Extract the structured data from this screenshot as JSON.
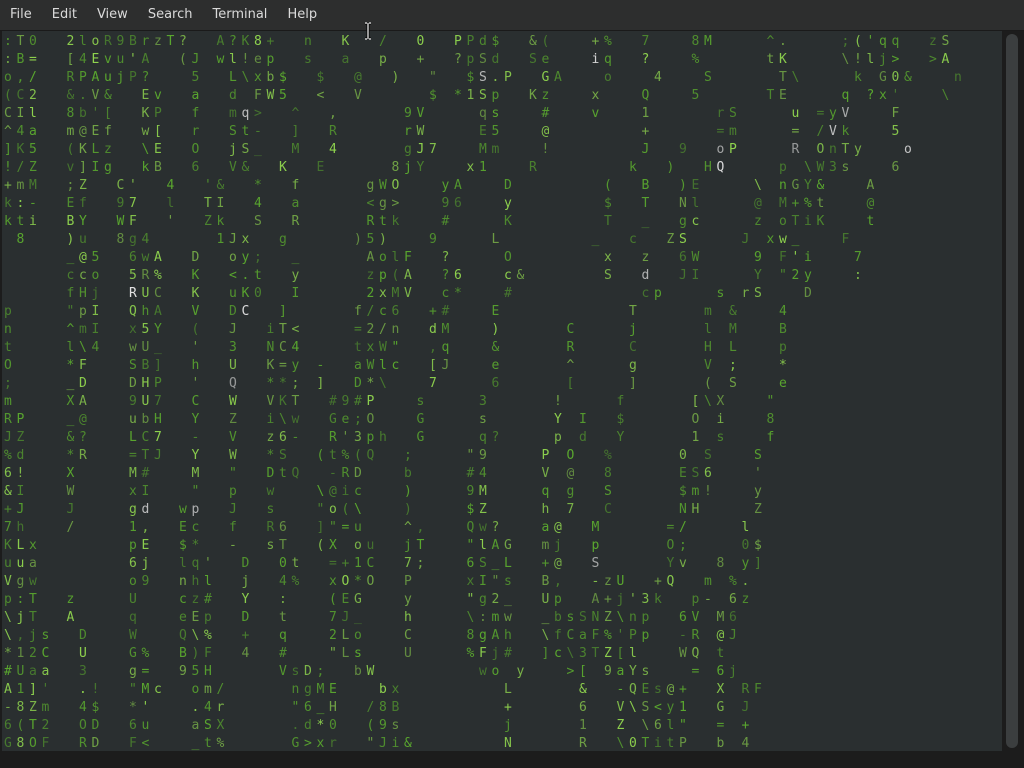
{
  "menubar": {
    "items": [
      {
        "label": "File"
      },
      {
        "label": "Edit"
      },
      {
        "label": "View"
      },
      {
        "label": "Search"
      },
      {
        "label": "Terminal"
      },
      {
        "label": "Help"
      }
    ]
  },
  "colors": {
    "terminal_background": "#2a2f30",
    "rain_green": "#5aa82e",
    "rain_green_bright": "#8fd44e",
    "highlight_white": "#e8e8e8",
    "menubar_background": "#2d2e2e",
    "menubar_text": "#dadada"
  },
  "icons": {
    "cursor": "ibeam-cursor-icon",
    "scrollbar": "scrollbar-thumb"
  },
  "terminal": {
    "rows": [
      ":T0  2loR9BrzT?  A?K8+  n  K  /  0  PPd$  &(   +%  7   8M    ^.    ;('qq  zS",
      ":B=  [4Evu'A  (J wl!ep  s  a  p  +  ?pSd  Se   iq  ?   %     tK    \\!lj>  >A",
      "o,/  RPAujP?   5  L\\xb$  $  @  )  \"  $S.P  GA   o   4   S     T\\    k G0&   n",
      "(C2  &.V&  Ev  a  d FW5  <  V     $ *1Sp  Kz   x   Q   5     TE    q ?x'   \\",
      "CIl  8b'[  KP  f  mq>  ^  ,     9V    qs   #   v   1     rS    u =yV   F",
      "^4a  m@Ef  w[  r  St-  ]  R     rW    E5   @       +     =m    = /Vk   5",
      "]K5  (KLz  \\E  O  jS_  M  4     gJ7   Mm   !       J  9  oP    R OnTy   o",
      "!/Z  v]Ig  kB  6  V&  K  E     8jY   x1   R       k  )  HQ    p \\W3s   6",
      "+mM  ;Z  C'  4  '&  *  f     gWO   yA   D       (  B  )E    \\ nGY&   A",
      "k:-  Ef  97  l  TI  4  a     <g>   96   y       $  T  Nl    @ M+%t   @",
      "kti  BY  WF  '  Zk  S  R     Rtk   #    K       T  _  gc    z oTiK   t",
      " 8   )u  8g4     1Jx  g     )5)   9    L       _  c  ZS    J xw_   F",
      "     _@5  6wA  D  oy;  _     AolF  ?    O       x  z  6W    9 F'i   7",
      "     cco  5R%  K  <.t  y     zp(A  ?6   c&      S  d  JI    Y \"2y   :",
      "     fHj  RUC  K  uK0  I     2xMV  c*   #          cp    s rS   D",
      "p    \"pI  QhA  V  DC  ]     f/c6  +#   E          T     m &   4",
      "n    ^mI  x5Y  (  J  iT<    =2/n  dM   )     C    j     l M   B",
      "t    l\\4  wU_  '  3  NC4    txW\"  ,q   &     R    C     H L   p",
      "O    *F   SB]  h  U  K=y -  aWlc  [J   e     ^    g     V ;   *",
      ";    _D   DHP  '  Q  **; ]  D*\\   7    6     [    ]     ( S   e",
      "m    XA   9U7  C  W  VKT  #9#P   s    3     !    f     [\\X   \"",
      "RP   _@   ubH  Y  Z  i\\w  Ge;O   G    s     Y I  $     O i   8",
      "JZ   &?   LC7  -  V  z6-  R'3ph  G    q?    p d  Y     1 s   f",
      "%d   *R   =TJ  Y  W  *S  (t%(Q  ;    \"9    P O  %     0 S   S",
      "6!   X    M#   M  \"  DtQ  -RD   b    #4    V @  8     ES6   '",
      "&I   W    xI   \"  p  w   \\@ic   )    9M    q g  S     $m!   y",
      "+J   J    gd  wp  J  s   \"o(\\   )    $Z    h 7  C     NH    Z",
      "7h   /    1,  Ec  f  R6  ]\"=u   ^,   Qw?   a@  M     =/    l",
      "KLx       pE  $*  -  sT  (X ou  jT   \"lAG  mj  p     O;    0$",
      "uua       6j  lq'  D  0t  =+1C  7;   6S_L  +@  S     Yv  8 y]",
      "Vgw       o9  nhl  j  4%  xO*O  P    xI\"s  B,  -zU  +Q  m %.",
      "p:T  z    U   cz#  Y  :   (EG   y    \"g2_  Up  A+j'3k  p- 6z",
      "\\jT  A    q   eEp  D  t   7J_   h    \\:mw  _bsSNZ\\np  6V M6",
      "\\,js  D   W   Q\\%  +  q   2Lo   C    8gAh  \\fCaF%'Pp  -R @J",
      "*12C  U   G%  B)F  4  #   \"Ls   U    %Fj#  ]c\\3TZ[l   WQ t",
      "#Uaa  3   g=  95H     VsD;  bW        wo y   >[ 9aYs   = 6j",
      "A1]'  .!  \"Mc  om/     ngME   bx        L     &  -QEs@+  X RF",
      "-8Zm  4$  *'   .4r     \"6_H  /8B        +     6  V\\S<y1  G J",
      "6(T2  OD  6u   aSX     .d*0  (9s        j     1  Z \\6l\"  = +",
      "G8OF  RD  F<   _t%     G>xr  \"Ji&       N     R  \\0TitP  b 4"
    ]
  }
}
